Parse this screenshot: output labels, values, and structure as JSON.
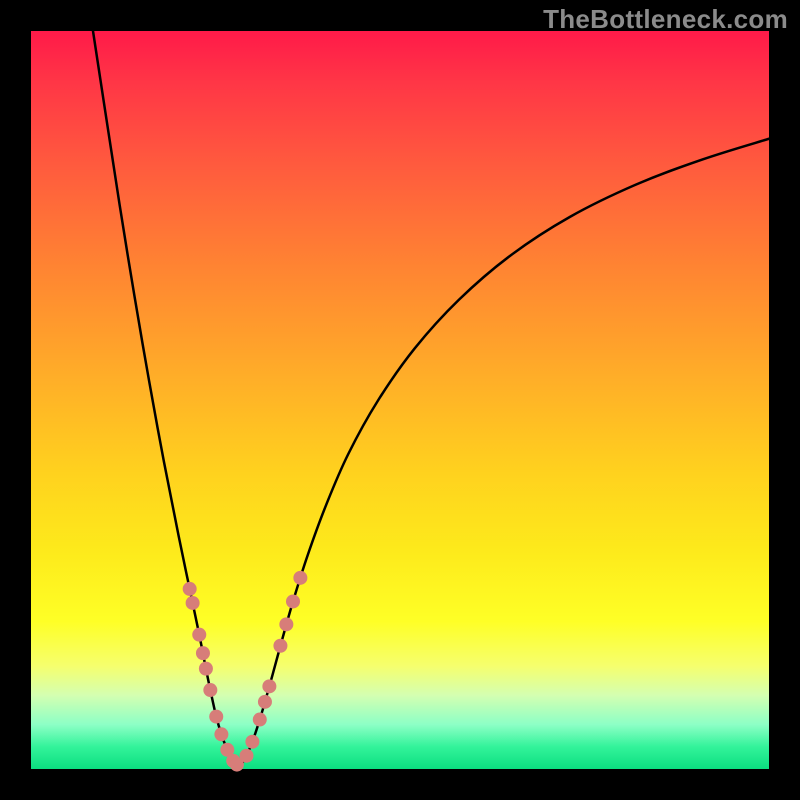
{
  "watermark": "TheBottleneck.com",
  "colors": {
    "curve": "#000000",
    "dot_fill": "#d77d79",
    "dot_stroke": "#c56962"
  },
  "chart_data": {
    "type": "line",
    "title": "",
    "xlabel": "",
    "ylabel": "",
    "xlim": [
      0,
      100
    ],
    "ylim": [
      0,
      100
    ],
    "axes_visible": false,
    "series": [
      {
        "name": "left-curve",
        "x": [
          8.4,
          10,
          12,
          14,
          16,
          18,
          20,
          21.5,
          22.8,
          23.7,
          24.3,
          25.1,
          25.8,
          26.6,
          27.4,
          27.9
        ],
        "y": [
          100,
          89.5,
          76.5,
          64.2,
          52.6,
          41.7,
          31.6,
          24.4,
          18.2,
          13.6,
          10.7,
          7.1,
          4.7,
          2.6,
          1.1,
          0.6
        ]
      },
      {
        "name": "right-curve",
        "x": [
          28.5,
          29.2,
          30.0,
          31.0,
          32.3,
          33.8,
          35.5,
          37.5,
          40,
          43,
          47,
          52,
          58,
          65,
          73,
          82,
          91,
          100
        ],
        "y": [
          0.6,
          1.8,
          3.7,
          6.7,
          11.2,
          16.7,
          22.7,
          29.0,
          35.8,
          42.7,
          49.9,
          57.0,
          63.6,
          69.6,
          74.8,
          79.2,
          82.6,
          85.4
        ]
      }
    ],
    "highlight_points": {
      "left": [
        [
          21.5,
          24.4
        ],
        [
          21.9,
          22.5
        ],
        [
          22.8,
          18.2
        ],
        [
          23.3,
          15.7
        ],
        [
          23.7,
          13.6
        ],
        [
          24.3,
          10.7
        ],
        [
          25.1,
          7.1
        ],
        [
          25.8,
          4.7
        ],
        [
          26.6,
          2.6
        ],
        [
          27.4,
          1.1
        ],
        [
          27.9,
          0.6
        ]
      ],
      "right": [
        [
          29.2,
          1.8
        ],
        [
          30.0,
          3.7
        ],
        [
          31.0,
          6.7
        ],
        [
          31.7,
          9.1
        ],
        [
          32.3,
          11.2
        ],
        [
          33.8,
          16.7
        ],
        [
          34.6,
          19.6
        ],
        [
          35.5,
          22.7
        ],
        [
          36.5,
          25.9
        ]
      ]
    },
    "style": {
      "dot_radius_px": 7,
      "curve_stroke_px": 2.5
    }
  }
}
